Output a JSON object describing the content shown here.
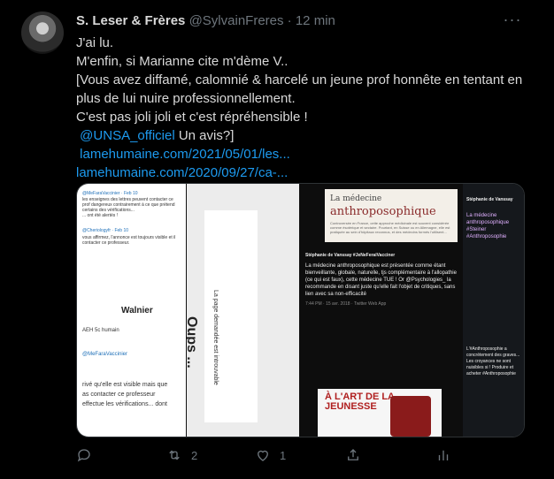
{
  "tweet": {
    "author_name": "S. Leser & Frères",
    "handle": "@SylvainFreres",
    "separator": "·",
    "time": "12 min",
    "more": "···",
    "lines": [
      "J'ai lu.",
      "M'enfin, si Marianne cite m'dème V..",
      "[Vous avez diffamé, calomnié & harcelé un jeune prof honnête en tentant en plus de lui nuire professionnellement.",
      "C'est pas joli joli et c'est répréhensible !"
    ],
    "mention": "@UNSA_officiel",
    "mention_tail": " Un avis?]",
    "link1": "lamehumaine.com/2021/05/01/les...",
    "link2": "lamehumaine.com/2020/09/27/ca-..."
  },
  "media": {
    "panel1": {
      "lines": [
        "@MeFaraVaccinier · Feb 10",
        "les enseignes des lettres peuvent contacter ce",
        "prof dangereux contrairement à ce que prétend",
        "certains des vérifications...",
        "... ont été alertés !",
        "",
        "@Cheriologyfr · Feb 10",
        "vous affirmez, l'annonce est toujours visible et il",
        "contacter ce professeur."
      ],
      "walnier": "Walnier",
      "lines2": [
        "AEH 5c humain",
        "@MeFaraVaccinier",
        "",
        "rivé qu'elle est visible mais que",
        "as contacter ce professeur",
        "effectue les vérifications... dont"
      ]
    },
    "panel2": {
      "oups": "Oups ...",
      "sub": "La page demandée est introuvable"
    },
    "panel3": {
      "article_small": "La médecine",
      "article_big": "anthroposophique",
      "article_text": "Controversée en France, cette approche médicinale est souvent considérée comme ésotérique et sectaire. Pourtant, en Suisse ou en Allemagne, elle est pratiquée au sein d'hôpitaux reconnus, et des médecins formés l'utilisent...",
      "quote_author": "Stéphanie de Vanssay #JeNeFeraiVacciner",
      "quote_text": "La médecine anthroposophique est présentée comme étant bienveillante, globale, naturelle, tjs complémentaire à l'allopathie (ce qui est faux), cette médecine TUE ! Or @Psychologies_ la recommande en disant juste qu'elle fait l'objet de critiques, sans lien avec sa non-efficacité",
      "quote_meta": "7:44 PM · 15 avr. 2018 · Twitter Web App",
      "book_title": "À L'ART DE LA JEUNESSE",
      "side_author": "Stéphanie de Vanssay",
      "side_text": "La médecine anthroposophique #Steiner #Anthroposophie",
      "side_text2": "L'#Anthroposophie a concrètement des graves... Les croyances ne sont nuisibles si ! Produire et acheter #Anthroposophie"
    }
  },
  "actions": {
    "reply_count": "",
    "retweet_count": "2",
    "like_count": "1"
  },
  "colors": {
    "background": "#000000",
    "text": "#d9d9d9",
    "muted": "#6e767d",
    "link": "#1d9bf0"
  }
}
